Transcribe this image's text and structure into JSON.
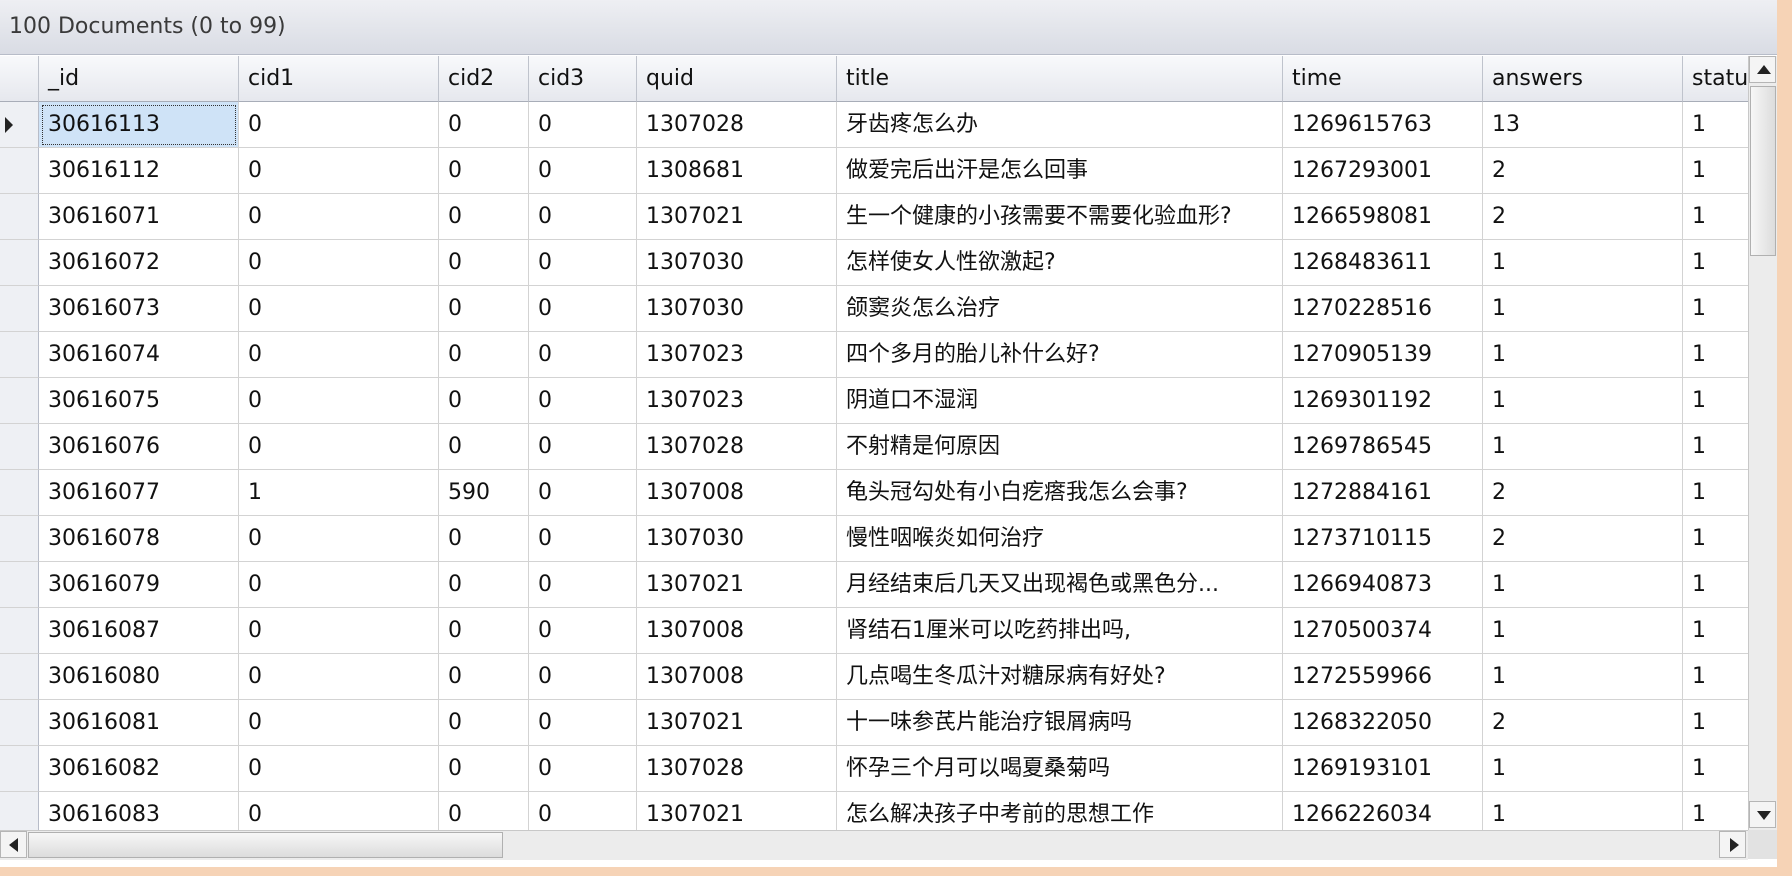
{
  "header": {
    "document_count": "100 Documents (0 to 99)"
  },
  "columns": [
    "_id",
    "cid1",
    "cid2",
    "cid3",
    "quid",
    "title",
    "time",
    "answers",
    "statu"
  ],
  "rows": [
    [
      "30616113",
      "0",
      "0",
      "0",
      "1307028",
      "牙齿疼怎么办",
      "1269615763",
      "13",
      "1"
    ],
    [
      "30616112",
      "0",
      "0",
      "0",
      "1308681",
      "做爱完后出汗是怎么回事",
      "1267293001",
      "2",
      "1"
    ],
    [
      "30616071",
      "0",
      "0",
      "0",
      "1307021",
      "生一个健康的小孩需要不需要化验血形?",
      "1266598081",
      "2",
      "1"
    ],
    [
      "30616072",
      "0",
      "0",
      "0",
      "1307030",
      "怎样使女人性欲激起?",
      "1268483611",
      "1",
      "1"
    ],
    [
      "30616073",
      "0",
      "0",
      "0",
      "1307030",
      "颌窦炎怎么治疗",
      "1270228516",
      "1",
      "1"
    ],
    [
      "30616074",
      "0",
      "0",
      "0",
      "1307023",
      "四个多月的胎儿补什么好?",
      "1270905139",
      "1",
      "1"
    ],
    [
      "30616075",
      "0",
      "0",
      "0",
      "1307023",
      "阴道口不湿润",
      "1269301192",
      "1",
      "1"
    ],
    [
      "30616076",
      "0",
      "0",
      "0",
      "1307028",
      "不射精是何原因",
      "1269786545",
      "1",
      "1"
    ],
    [
      "30616077",
      "1",
      "590",
      "0",
      "1307008",
      "龟头冠勾处有小白疙瘩我怎么会事?",
      "1272884161",
      "2",
      "1"
    ],
    [
      "30616078",
      "0",
      "0",
      "0",
      "1307030",
      "慢性咽喉炎如何治疗",
      "1273710115",
      "2",
      "1"
    ],
    [
      "30616079",
      "0",
      "0",
      "0",
      "1307021",
      "月经结束后几天又出现褐色或黑色分...",
      "1266940873",
      "1",
      "1"
    ],
    [
      "30616087",
      "0",
      "0",
      "0",
      "1307008",
      "肾结石1厘米可以吃药排出吗,",
      "1270500374",
      "1",
      "1"
    ],
    [
      "30616080",
      "0",
      "0",
      "0",
      "1307008",
      "几点喝生冬瓜汁对糖尿病有好处?",
      "1272559966",
      "1",
      "1"
    ],
    [
      "30616081",
      "0",
      "0",
      "0",
      "1307021",
      "十一味参芪片能治疗银屑病吗",
      "1268322050",
      "2",
      "1"
    ],
    [
      "30616082",
      "0",
      "0",
      "0",
      "1307028",
      "怀孕三个月可以喝夏桑菊吗",
      "1269193101",
      "1",
      "1"
    ],
    [
      "30616083",
      "0",
      "0",
      "0",
      "1307021",
      "怎么解决孩子中考前的思想工作",
      "1266226034",
      "1",
      "1"
    ]
  ],
  "selected_row": 0,
  "icons": {
    "row_pointer": "row-pointer-icon",
    "scroll_up": "arrow-up-icon",
    "scroll_down": "arrow-down-icon",
    "scroll_left": "arrow-left-icon",
    "scroll_right": "arrow-right-icon"
  }
}
